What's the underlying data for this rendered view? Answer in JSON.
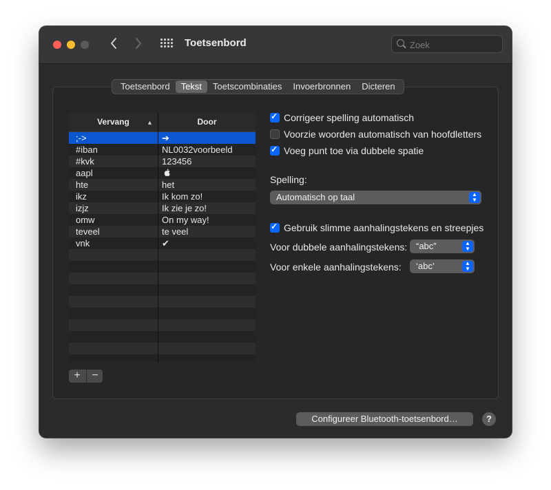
{
  "window": {
    "title": "Toetsenbord"
  },
  "titlebar": {
    "back_icon": "chevron-left-icon",
    "forward_icon": "chevron-right-icon",
    "grid_icon": "grid-icon"
  },
  "search": {
    "placeholder": "Zoek",
    "value": ""
  },
  "tabs": [
    {
      "label": "Toetsenbord",
      "active": false
    },
    {
      "label": "Tekst",
      "active": true
    },
    {
      "label": "Toetscombinaties",
      "active": false
    },
    {
      "label": "Invoerbronnen",
      "active": false
    },
    {
      "label": "Dicteren",
      "active": false
    }
  ],
  "table": {
    "headers": {
      "replace": "Vervang",
      "with": "Door"
    },
    "rows": [
      {
        "replace": ";->",
        "with": "➔",
        "selected": true
      },
      {
        "replace": "#iban",
        "with": "NL0032voorbeeld"
      },
      {
        "replace": "#kvk",
        "with": "123456"
      },
      {
        "replace": "aapl",
        "with": ""
      },
      {
        "replace": "hte",
        "with": "het"
      },
      {
        "replace": "ikz",
        "with": "Ik kom zo!"
      },
      {
        "replace": "izjz",
        "with": "Ik zie je zo!"
      },
      {
        "replace": "omw",
        "with": "On my way!"
      },
      {
        "replace": "teveel",
        "with": "te veel"
      },
      {
        "replace": "vnk",
        "with": "✔"
      }
    ],
    "add_label": "+",
    "remove_label": "−"
  },
  "options": {
    "spelling_auto": {
      "label": "Corrigeer spelling automatisch",
      "checked": true
    },
    "capitalize": {
      "label": "Voorzie woorden automatisch van hoofdletters",
      "checked": false
    },
    "double_space": {
      "label": "Voeg punt toe via dubbele spatie",
      "checked": true
    },
    "spelling_label": "Spelling:",
    "spelling_value": "Automatisch op taal",
    "smart_quotes": {
      "label": "Gebruik slimme aanhalingstekens en streepjes",
      "checked": true
    },
    "double_quotes_label": "Voor dubbele aanhalingstekens:",
    "double_quotes_value": "“abc”",
    "single_quotes_label": "Voor enkele aanhalingstekens:",
    "single_quotes_value": "‘abc’"
  },
  "footer": {
    "bluetooth_button": "Configureer Bluetooth-toetsenbord…",
    "help_label": "?"
  },
  "colors": {
    "accent": "#0a64ff",
    "selection": "#0a57d0",
    "close": "#fe5f57",
    "minimize": "#febc2e"
  }
}
